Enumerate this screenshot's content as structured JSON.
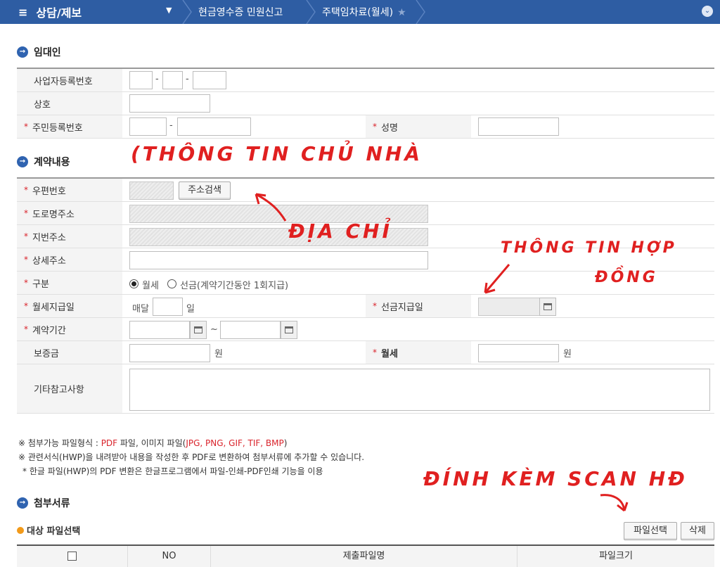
{
  "topbar": {
    "menu_label": "상담/제보",
    "crumbs": [
      "현금영수증 민원신고",
      "주택임차료(월세)"
    ]
  },
  "sections": {
    "landlord": "임대인",
    "contract": "계약내용",
    "attach": "첨부서류"
  },
  "landlord": {
    "biz_no_label": "사업자등록번호",
    "company_label": "상호",
    "resident_no_label": "주민등록번호",
    "name_label": "성명"
  },
  "contract": {
    "zip_label": "우편번호",
    "zip_search_button": "주소검색",
    "road_addr_label": "도로명주소",
    "lot_addr_label": "지번주소",
    "detail_addr_label": "상세주소",
    "type_label": "구분",
    "type_options": [
      "월세",
      "선금(계약기간동안 1회지급)"
    ],
    "pay_day_label": "월세지급일",
    "pay_day_prefix": "매달",
    "pay_day_suffix": "일",
    "prepay_date_label": "선금지급일",
    "period_label": "계약기간",
    "period_sep": "~",
    "deposit_label": "보증금",
    "won": "원",
    "rent_label": "월세",
    "notes_label": "기타참고사항"
  },
  "notes": {
    "line1_a": "※ 첨부가능 파일형식 : ",
    "line1_pdf": "PDF",
    "line1_b": " 파일, 이미지 파일(",
    "line1_img": "JPG, PNG, GIF, TIF, BMP",
    "line1_c": ")",
    "line2": "※ 관련서식(HWP)을 내려받아 내용을 작성한 후 PDF로 변환하여 첨부서류에 추가할 수 있습니다.",
    "line3": "* 한글 파일(HWP)의 PDF 변환은 한글프로그램에서 파일-인쇄-PDF인쇄 기능을 이용"
  },
  "attach": {
    "subtitle": "대상 파일선택",
    "select_button": "파일선택",
    "delete_button": "삭제",
    "columns": [
      "NO",
      "제출파일명",
      "파일크기"
    ]
  },
  "annotations": {
    "landlord_info": "(THÔNG TIN CHỦ NHÀ",
    "address": "ĐỊA CHỈ",
    "contract_info_1": "THÔNG TIN HỢP",
    "contract_info_2": "ĐỒNG",
    "attach_scan": "ĐÍNH KÈM SCAN HĐ"
  },
  "colors": {
    "topbar": "#2e5da3",
    "required": "#d9232b",
    "annotation": "#e02020"
  }
}
